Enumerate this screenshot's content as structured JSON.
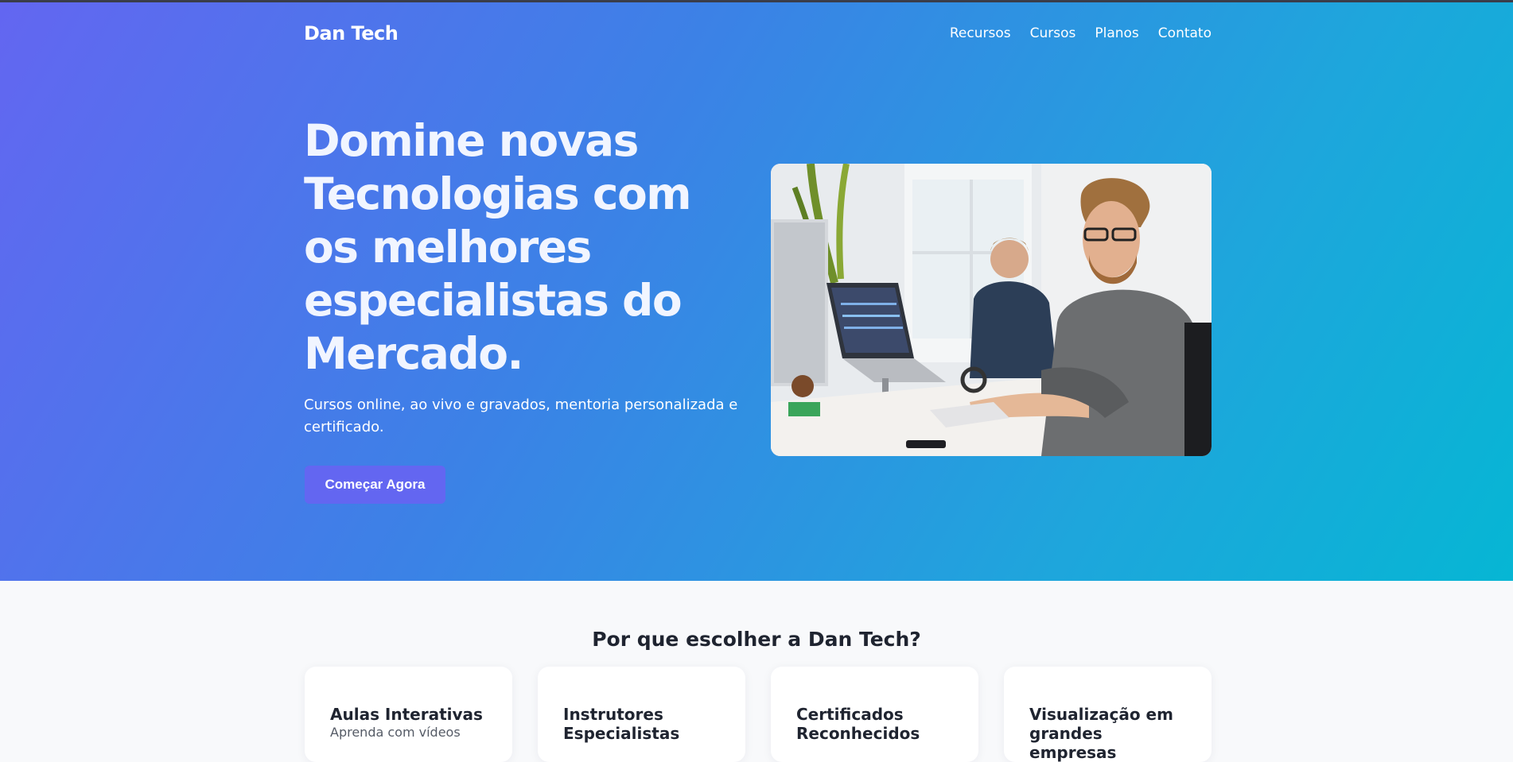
{
  "header": {
    "brand": "Dan Tech",
    "nav": [
      "Recursos",
      "Cursos",
      "Planos",
      "Contato"
    ]
  },
  "hero": {
    "title": "Domine novas Tecnologias com os melhores especialistas do Mercado.",
    "subtitle": "Cursos online, ao vivo e gravados, mentoria personalizada e certificado.",
    "cta_label": "Começar Agora"
  },
  "features": {
    "heading": "Por que escolher a Dan Tech?",
    "cards": [
      {
        "title": "Aulas Interativas",
        "text": "Aprenda com vídeos"
      },
      {
        "title": "Instrutores Especialistas",
        "text": ""
      },
      {
        "title": "Certificados Reconhecidos",
        "text": ""
      },
      {
        "title": "Visualização em grandes empresas",
        "text": ""
      }
    ]
  },
  "colors": {
    "hero_gradient_start": "#6366f1",
    "hero_gradient_end": "#06b6d4",
    "cta_background": "#6366f1",
    "page_background": "#f8f9fb"
  }
}
